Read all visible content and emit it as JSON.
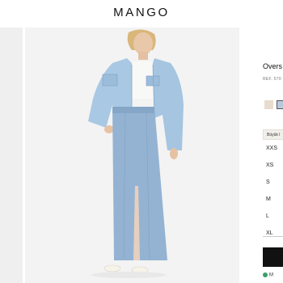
{
  "header": {
    "logo": "MANGO"
  },
  "product": {
    "title": "Overs",
    "ref": "REF. 570"
  },
  "colors": [
    {
      "name": "beige-swatch",
      "hex": "#e7dccd",
      "selected": false
    },
    {
      "name": "light-blue-swatch",
      "hex": "#b9c9dc",
      "selected": true
    }
  ],
  "size_guide_label": "Büyük l",
  "sizes": [
    "XXS",
    "XS",
    "S",
    "M",
    "L",
    "XL"
  ],
  "favorites_label": "M",
  "icons": {
    "favorite": "favorite-icon"
  }
}
